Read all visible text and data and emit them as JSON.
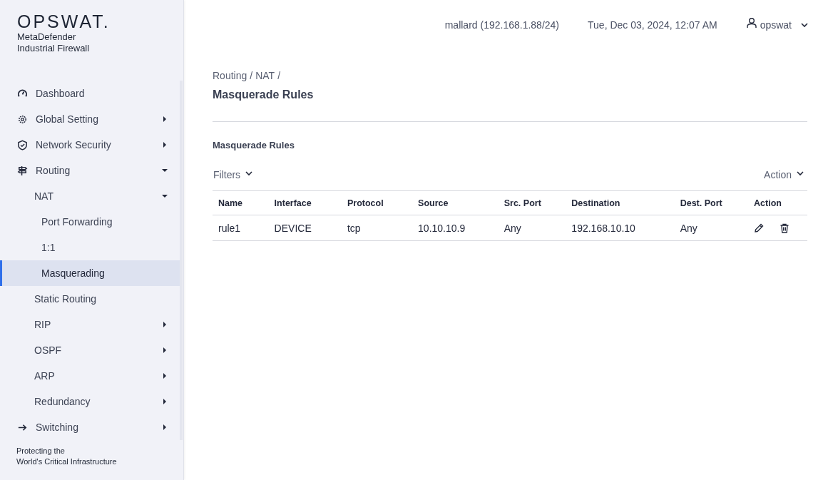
{
  "brand": {
    "logo": "OPSWAT.",
    "product_line1": "MetaDefender",
    "product_line2": "Industrial Firewall"
  },
  "sidebar": {
    "items": [
      {
        "label": "Dashboard",
        "selected": false
      },
      {
        "label": "Global Setting",
        "selected": false,
        "expanded": false
      },
      {
        "label": "Network Security",
        "selected": false,
        "expanded": false
      },
      {
        "label": "Routing",
        "selected": false,
        "expanded": true,
        "children": [
          {
            "label": "NAT",
            "selected": false,
            "expanded": true,
            "children": [
              {
                "label": "Port Forwarding",
                "selected": false
              },
              {
                "label": "1:1",
                "selected": false
              },
              {
                "label": "Masquerading",
                "selected": true
              }
            ]
          },
          {
            "label": "Static Routing",
            "selected": false
          },
          {
            "label": "RIP",
            "selected": false,
            "expanded": false
          },
          {
            "label": "OSPF",
            "selected": false,
            "expanded": false
          },
          {
            "label": "ARP",
            "selected": false,
            "expanded": false
          },
          {
            "label": "Redundancy",
            "selected": false,
            "expanded": false
          }
        ]
      },
      {
        "label": "Switching",
        "selected": false,
        "expanded": false
      }
    ],
    "footer_line1": "Protecting the",
    "footer_line2": "World's Critical Infrastructure"
  },
  "header": {
    "host": "mallard (192.168.1.88/24)",
    "datetime": "Tue, Dec 03, 2024, 12:07 AM",
    "user": "opswat"
  },
  "breadcrumb": [
    "Routing",
    "/",
    "NAT",
    "/"
  ],
  "page_title": "Masquerade Rules",
  "section_title": "Masquerade Rules",
  "toolbar": {
    "filters": "Filters",
    "action": "Action"
  },
  "table": {
    "columns": [
      "Name",
      "Interface",
      "Protocol",
      "Source",
      "Src. Port",
      "Destination",
      "Dest. Port",
      "Action"
    ],
    "rows": [
      {
        "cells": [
          "rule1",
          "DEVICE",
          "tcp",
          "10.10.10.9",
          "Any",
          "192.168.10.10",
          "Any"
        ]
      }
    ]
  }
}
